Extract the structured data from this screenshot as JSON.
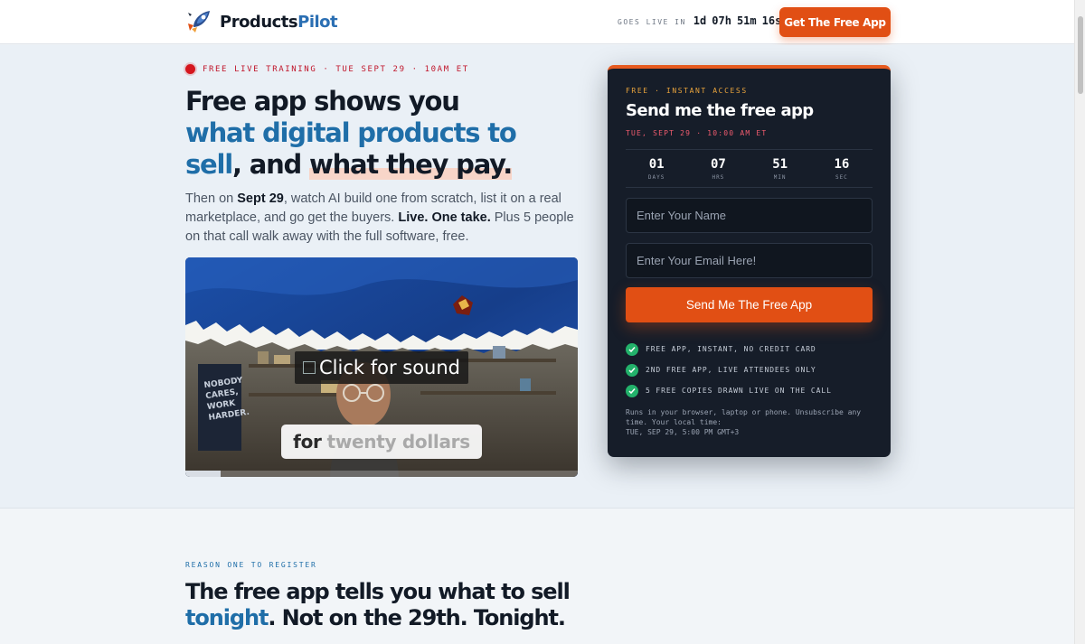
{
  "header": {
    "brand_a": "Products",
    "brand_b": "Pilot",
    "countdown_label": "GOES LIVE IN",
    "countdown": [
      "1d",
      "07h",
      "51m",
      "16s"
    ],
    "cta": "Get The Free App"
  },
  "hero": {
    "badge": "FREE LIVE TRAINING · TUE SEPT 29 · 10AM ET",
    "headline": {
      "line1": "Free app shows you",
      "line2_blue": "what digital products to",
      "line3_blue": "sell",
      "line3_mid": ", and ",
      "line3_highlight": "what they pay."
    },
    "sub": {
      "p1": "Then on ",
      "p2_bold": "Sept 29",
      "p3": ", watch AI build one from scratch, list it on a real marketplace, and go get the buyers. ",
      "p4_bold": "Live. One take.",
      "p5": " Plus 5 people on that call walk away with the full software, free."
    },
    "video": {
      "sound_button": "Click for sound",
      "caption_a": "for",
      "caption_b": "twenty dollars",
      "poster_text": [
        "NOBODY",
        "CARES,",
        "WORK",
        "HARDER."
      ],
      "progress": 0.09
    }
  },
  "form_card": {
    "eyebrow": "FREE · INSTANT ACCESS",
    "title": "Send me the free app",
    "date": "TUE, SEPT 29 · 10:00 AM ET",
    "timer": [
      {
        "value": "01",
        "label": "DAYS"
      },
      {
        "value": "07",
        "label": "HRS"
      },
      {
        "value": "51",
        "label": "MIN"
      },
      {
        "value": "16",
        "label": "SEC"
      }
    ],
    "name_placeholder": "Enter Your Name",
    "email_placeholder": "Enter Your Email Here!",
    "submit": "Send Me The Free App",
    "checks": [
      "FREE APP, INSTANT, NO CREDIT CARD",
      "2ND FREE APP, LIVE ATTENDEES ONLY",
      "5 FREE COPIES DRAWN LIVE ON THE CALL"
    ],
    "fine_print_1": "Runs in your browser, laptop or phone. Unsubscribe any time. Your local time:",
    "fine_print_2": "TUE, SEP 29, 5:00 PM GMT+3"
  },
  "section2": {
    "eyebrow": "REASON ONE TO REGISTER",
    "title_a": "The free app tells you what to sell",
    "title_blue": "tonight",
    "title_b": ". Not on the 29th. Tonight."
  },
  "colors": {
    "accent_orange": "#e14f14",
    "brand_blue": "#1f6ea8",
    "card_bg": "#161d29",
    "check_green": "#23b26b",
    "live_red": "#d5161e"
  }
}
